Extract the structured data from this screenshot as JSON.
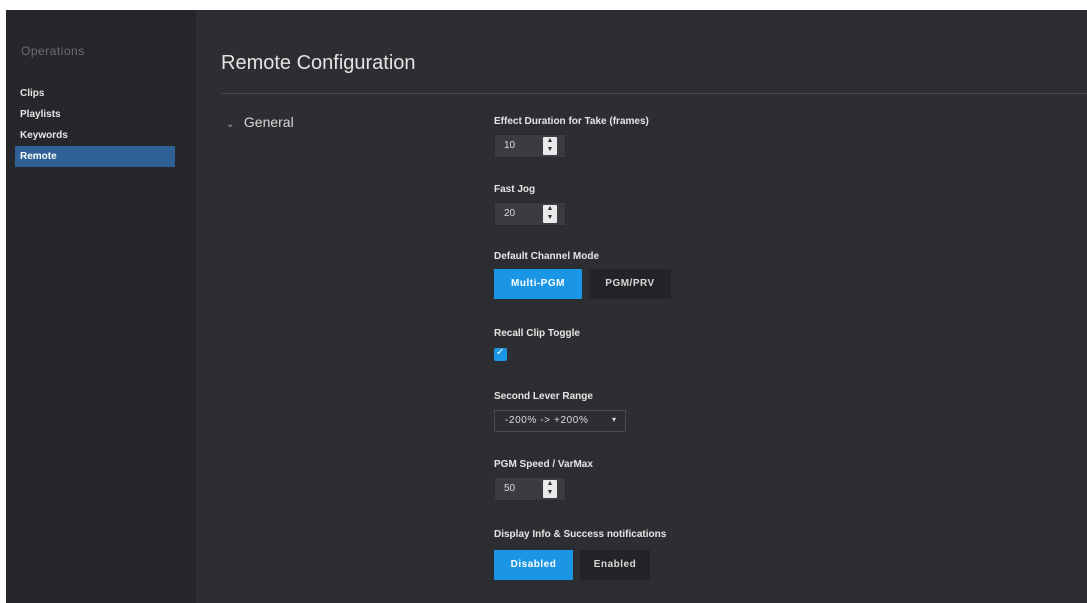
{
  "sidebar": {
    "title": "Operations",
    "items": [
      {
        "label": "Clips"
      },
      {
        "label": "Playlists"
      },
      {
        "label": "Keywords"
      },
      {
        "label": "Remote"
      }
    ]
  },
  "header": {
    "title": "Remote Configuration"
  },
  "section": {
    "chevron": "⌄",
    "label": "General"
  },
  "fields": {
    "effect_duration": {
      "label": "Effect Duration for Take (frames)",
      "value": "10"
    },
    "fast_jog": {
      "label": "Fast Jog",
      "value": "20"
    },
    "channel_mode": {
      "label": "Default Channel Mode",
      "options": [
        "Multi-PGM",
        "PGM/PRV"
      ],
      "selected": "Multi-PGM"
    },
    "recall_clip": {
      "label": "Recall Clip Toggle",
      "checked": true,
      "check_glyph": "✓"
    },
    "second_lever": {
      "label": "Second Lever Range",
      "value": "-200% -> +200%",
      "caret": "▾"
    },
    "pgm_speed": {
      "label": "PGM Speed / VarMax",
      "value": "50"
    },
    "notifications": {
      "label": "Display Info & Success notifications",
      "options": [
        "Disabled",
        "Enabled"
      ],
      "selected": "Disabled"
    }
  },
  "icons": {
    "spin_up": "▲",
    "spin_down": "▼"
  },
  "colors": {
    "accent": "#1b96e6",
    "active_nav": "#2f6196",
    "background": "#2d2e32",
    "sidebar": "#26272a"
  }
}
